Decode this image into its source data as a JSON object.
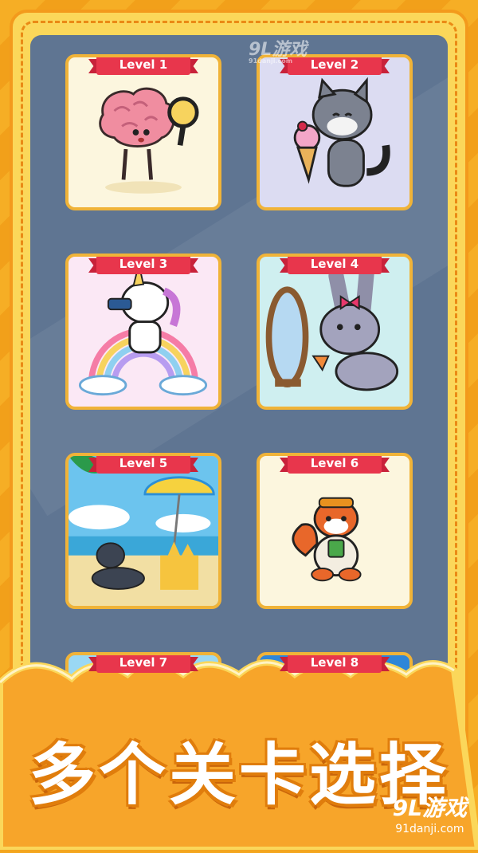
{
  "levels": [
    {
      "label": "Level 1",
      "art": "brain-with-magnifier"
    },
    {
      "label": "Level 2",
      "art": "cat-with-ice-cream"
    },
    {
      "label": "Level 3",
      "art": "unicorn-on-rainbow"
    },
    {
      "label": "Level 4",
      "art": "bunny-at-mirror"
    },
    {
      "label": "Level 5",
      "art": "cat-on-beach"
    },
    {
      "label": "Level 6",
      "art": "red-panda-with-mug"
    },
    {
      "label": "Level 7",
      "art": "partial"
    },
    {
      "label": "Level 8",
      "art": "partial"
    }
  ],
  "banner": {
    "title": "多个关卡选择"
  },
  "watermark": {
    "top_logo": "9L游戏",
    "top_site": "91danji.com",
    "bottom_logo": "9L游戏",
    "bottom_site": "91danji.com"
  },
  "colors": {
    "panel": "#5f7592",
    "frame": "#fbd75a",
    "ribbon": "#e8364c",
    "card_border": "#f0b338",
    "banner_orange": "#f39a1c"
  }
}
